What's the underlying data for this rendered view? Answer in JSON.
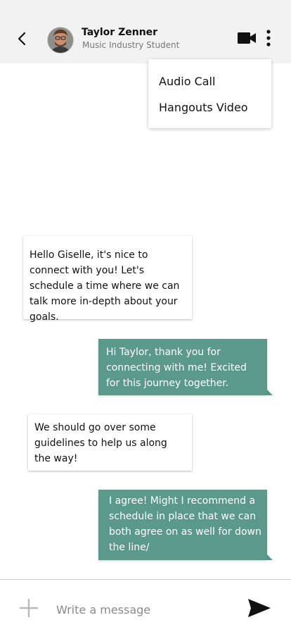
{
  "header": {
    "contact_name": "Taylor Zenner",
    "contact_subtitle": "Music Industry Student",
    "icons": [
      "back-arrow-icon",
      "avatar",
      "video-camera-icon",
      "more-vertical-icon"
    ]
  },
  "menu": {
    "items": [
      {
        "label": "Audio Call"
      },
      {
        "label": "Hangouts Video"
      }
    ]
  },
  "messages": [
    {
      "direction": "incoming",
      "text": "Hello Giselle, it's nice to connect with you! Let's schedule a time where we can talk more in-depth about your goals."
    },
    {
      "direction": "outgoing",
      "text": "Hi Taylor, thank you for connecting with me! Excited for this journey together."
    },
    {
      "direction": "incoming",
      "text": "We should go over some guidelines to help us along the way!"
    },
    {
      "direction": "outgoing",
      "text": "I agree! Might I recommend a schedule in place that we can both agree on as well for down the line/"
    }
  ],
  "composer": {
    "placeholder": "Write a message",
    "icons": [
      "plus-icon",
      "send-icon"
    ]
  },
  "colors": {
    "outgoing_bubble": "#5a998c",
    "incoming_bubble": "#ffffff",
    "background": "#ffffff",
    "header_background": "#f2f2f2"
  }
}
